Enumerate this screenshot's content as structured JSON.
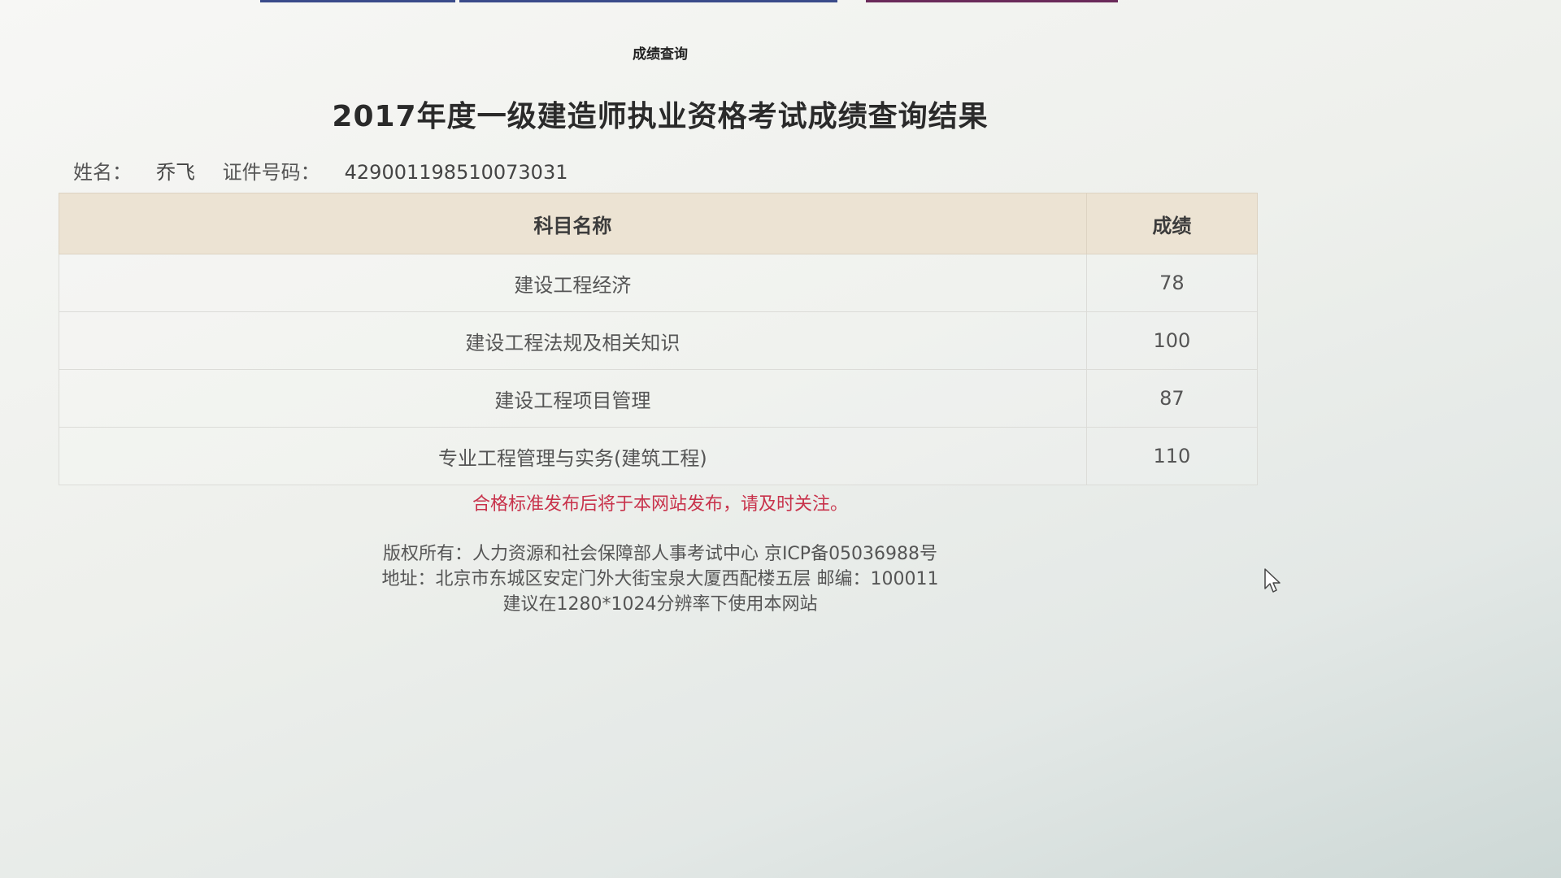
{
  "header": {
    "subtitle": "成绩查询",
    "title": "2017年度一级建造师执业资格考试成绩查询结果"
  },
  "candidate": {
    "name_label": "姓名：",
    "name": "乔飞",
    "id_label": "证件号码：",
    "id_number": "429001198510073031"
  },
  "table": {
    "headers": [
      "科目名称",
      "成绩"
    ],
    "rows": [
      {
        "subject": "建设工程经济",
        "score": "78"
      },
      {
        "subject": "建设工程法规及相关知识",
        "score": "100"
      },
      {
        "subject": "建设工程项目管理",
        "score": "87"
      },
      {
        "subject": "专业工程管理与实务(建筑工程)",
        "score": "110"
      }
    ]
  },
  "notice": "合格标准发布后将于本网站发布，请及时关注。",
  "footer": {
    "copyright": "版权所有：人力资源和社会保障部人事考试中心 京ICP备05036988号",
    "address": "地址：北京市东城区安定门外大街宝泉大厦西配楼五层 邮编：100011",
    "resolution": "建议在1280*1024分辨率下使用本网站"
  },
  "colors": {
    "notice": "#c8324b",
    "table_header_bg": "#ece3d3"
  }
}
